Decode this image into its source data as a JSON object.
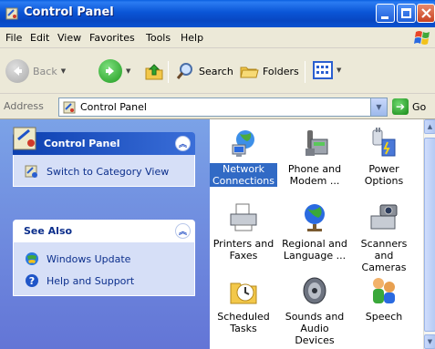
{
  "window": {
    "title": "Control Panel",
    "colors": {
      "titlebar": "#0a55d6",
      "taskpane": "#6c8be0",
      "selection": "#316ac5",
      "link": "#0c2f8c"
    }
  },
  "menu": [
    "File",
    "Edit",
    "View",
    "Favorites",
    "Tools",
    "Help"
  ],
  "toolbar": {
    "back_label": "Back",
    "search_label": "Search",
    "folders_label": "Folders"
  },
  "address": {
    "label": "Address",
    "value": "Control Panel",
    "go_label": "Go"
  },
  "taskpane": {
    "panel1": {
      "title": "Control Panel",
      "tasks": [
        "Switch to Category View"
      ]
    },
    "panel2": {
      "title": "See Also",
      "tasks": [
        "Windows Update",
        "Help and Support"
      ]
    }
  },
  "items": [
    {
      "label": "Network Connections",
      "icon": "network-connections-icon",
      "selected": true
    },
    {
      "label": "Phone and Modem ...",
      "icon": "phone-modem-icon",
      "selected": false
    },
    {
      "label": "Power Options",
      "icon": "power-options-icon",
      "selected": false
    },
    {
      "label": "Printers and Faxes",
      "icon": "printers-faxes-icon",
      "selected": false
    },
    {
      "label": "Regional and Language ...",
      "icon": "regional-language-icon",
      "selected": false
    },
    {
      "label": "Scanners and Cameras",
      "icon": "scanners-cameras-icon",
      "selected": false
    },
    {
      "label": "Scheduled Tasks",
      "icon": "scheduled-tasks-icon",
      "selected": false
    },
    {
      "label": "Sounds and Audio Devices",
      "icon": "sounds-audio-icon",
      "selected": false
    },
    {
      "label": "Speech",
      "icon": "speech-icon",
      "selected": false
    }
  ]
}
